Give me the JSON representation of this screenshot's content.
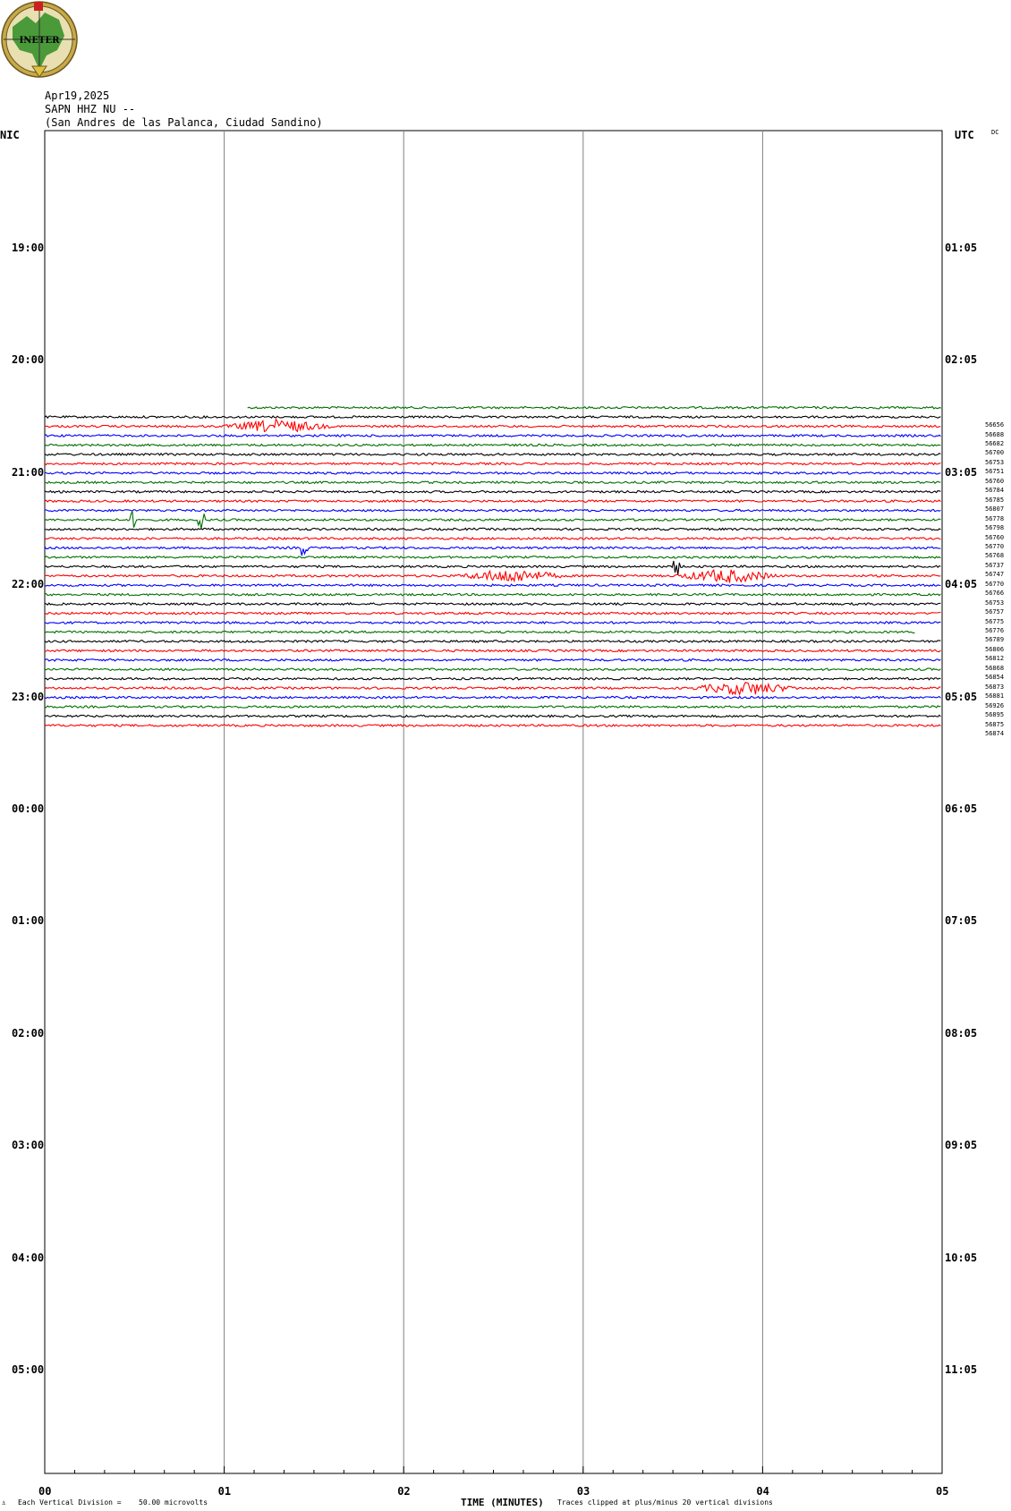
{
  "header": {
    "date": "Apr19,2025",
    "station": "SAPN HHZ NU --",
    "location": "(San Andres de las Palanca, Ciudad Sandino)",
    "logo_text": "INETER"
  },
  "left_tz": "NIC",
  "right_tz": "UTC",
  "dc_label": "DC",
  "footer": {
    "division": "Each Vertical Division =",
    "microvolts": "50.00 microvolts",
    "xlabel": "TIME (MINUTES)",
    "clip_note": "Traces clipped at plus/minus 20 vertical divisions"
  },
  "colors": {
    "cycle": [
      "#000000",
      "#ff0000",
      "#0000ff",
      "#007000"
    ],
    "grid": "#808080"
  },
  "chart_data": {
    "type": "line",
    "xlabel": "TIME (MINUTES)",
    "xlim": [
      0,
      5
    ],
    "x_ticks": [
      "00",
      "01",
      "02",
      "03",
      "04",
      "05"
    ],
    "left_hour_labels": [
      "19:00",
      "20:00",
      "21:00",
      "22:00",
      "23:00",
      "00:00",
      "01:00",
      "02:00",
      "03:00",
      "04:00",
      "05:00"
    ],
    "right_hour_labels": [
      "01:05",
      "02:05",
      "03:05",
      "04:05",
      "05:05",
      "06:05",
      "07:05",
      "08:05",
      "09:05",
      "10:05",
      "11:05"
    ],
    "trace_interval_minutes": 5,
    "first_trace_start_minute": 1.13,
    "last_trace_end_minute": 4.85,
    "trace_color_order": [
      "green",
      "black",
      "red",
      "blue"
    ],
    "traces": [
      {
        "start": "20:25",
        "value": null,
        "color": "green"
      },
      {
        "start": "20:30",
        "value": "56656",
        "color": "black"
      },
      {
        "start": "20:35",
        "value": "56688",
        "color": "red"
      },
      {
        "start": "20:40",
        "value": "56682",
        "color": "blue"
      },
      {
        "start": "20:45",
        "value": "56700",
        "color": "green"
      },
      {
        "start": "20:50",
        "value": "56753",
        "color": "black"
      },
      {
        "start": "20:55",
        "value": "56751",
        "color": "red"
      },
      {
        "start": "21:00",
        "value": "56760",
        "color": "blue"
      },
      {
        "start": "21:05",
        "value": "56784",
        "color": "green"
      },
      {
        "start": "21:10",
        "value": "56785",
        "color": "black"
      },
      {
        "start": "21:15",
        "value": "56807",
        "color": "red"
      },
      {
        "start": "21:20",
        "value": "56778",
        "color": "blue"
      },
      {
        "start": "21:25",
        "value": "56798",
        "color": "green"
      },
      {
        "start": "21:30",
        "value": "56760",
        "color": "black"
      },
      {
        "start": "21:35",
        "value": "56770",
        "color": "red"
      },
      {
        "start": "21:40",
        "value": "56768",
        "color": "blue"
      },
      {
        "start": "21:45",
        "value": "56737",
        "color": "green"
      },
      {
        "start": "21:50",
        "value": "56747",
        "color": "black"
      },
      {
        "start": "21:55",
        "value": "56770",
        "color": "red"
      },
      {
        "start": "22:00",
        "value": "56766",
        "color": "blue"
      },
      {
        "start": "22:05",
        "value": "56753",
        "color": "green"
      },
      {
        "start": "22:10",
        "value": "56757",
        "color": "black"
      },
      {
        "start": "22:15",
        "value": "56775",
        "color": "red"
      },
      {
        "start": "22:20",
        "value": "56776",
        "color": "blue"
      },
      {
        "start": "22:25",
        "value": "56789",
        "color": "green"
      },
      {
        "start": "22:30",
        "value": "56806",
        "color": "black"
      },
      {
        "start": "22:35",
        "value": "56812",
        "color": "red"
      },
      {
        "start": "22:40",
        "value": "56868",
        "color": "blue"
      },
      {
        "start": "22:45",
        "value": "56854",
        "color": "green"
      },
      {
        "start": "22:50",
        "value": "56873",
        "color": "black"
      },
      {
        "start": "22:55",
        "value": "56881",
        "color": "red"
      },
      {
        "start": "23:00",
        "value": "56926",
        "color": "blue"
      },
      {
        "start": "23:05",
        "value": "56895",
        "color": "green"
      },
      {
        "start": "23:10",
        "value": "56875",
        "color": "black"
      },
      {
        "start": "23:15",
        "value": "56874",
        "color": "red"
      }
    ],
    "events": [
      {
        "trace": "20:35",
        "minute": 1.3,
        "kind": "burst"
      },
      {
        "trace": "21:25",
        "minute": 0.5,
        "kind": "spike"
      },
      {
        "trace": "21:25",
        "minute": 0.87,
        "kind": "spike"
      },
      {
        "trace": "21:40",
        "minute": 1.45,
        "kind": "spike"
      },
      {
        "trace": "21:50",
        "minute": 3.52,
        "kind": "spike"
      },
      {
        "trace": "21:55",
        "minute": 2.6,
        "kind": "burst"
      },
      {
        "trace": "21:55",
        "minute": 3.8,
        "kind": "burst"
      },
      {
        "trace": "22:55",
        "minute": 3.9,
        "kind": "burst"
      }
    ]
  }
}
